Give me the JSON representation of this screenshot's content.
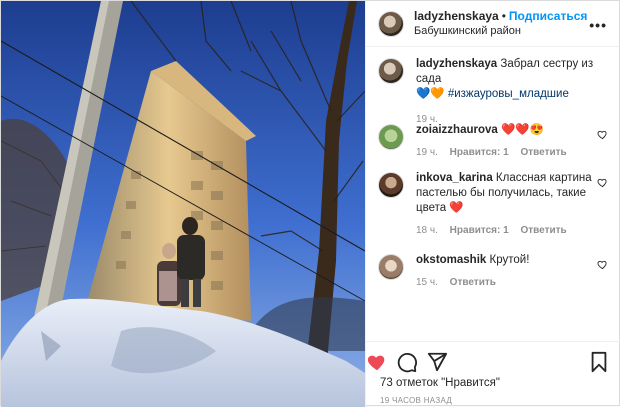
{
  "header": {
    "username": "ladyzhenskaya",
    "separator": "•",
    "follow_label": "Подписаться",
    "location": "Бабушкинский район",
    "more_icon": "more-horizontal-icon"
  },
  "caption": {
    "username": "ladyzhenskaya",
    "text": "Забрал сестру из сада",
    "emoji": "💙🧡",
    "hashtag": "#изжауровы_младшие",
    "time": "19 ч."
  },
  "comments": [
    {
      "username": "zoiaizzhaurova",
      "text": "❤️❤️😍",
      "time": "19 ч.",
      "likes": "Нравится: 1",
      "reply": "Ответить"
    },
    {
      "username": "inkova_karina",
      "text": "Классная картина пастелью бы получилась, такие цвета ❤️",
      "time": "18 ч.",
      "likes": "Нравится: 1",
      "reply": "Ответить"
    },
    {
      "username": "okstomashik",
      "text": "Крутой!",
      "time": "15 ч.",
      "reply": "Ответить"
    }
  ],
  "actions": {
    "like_icon": "heart-filled-icon",
    "comment_icon": "comment-icon",
    "share_icon": "share-icon",
    "save_icon": "bookmark-icon",
    "like_color": "#ed4956"
  },
  "likes_text": "73 отметок \"Нравится\"",
  "posted_ago": "19 ЧАСОВ НАЗАД"
}
